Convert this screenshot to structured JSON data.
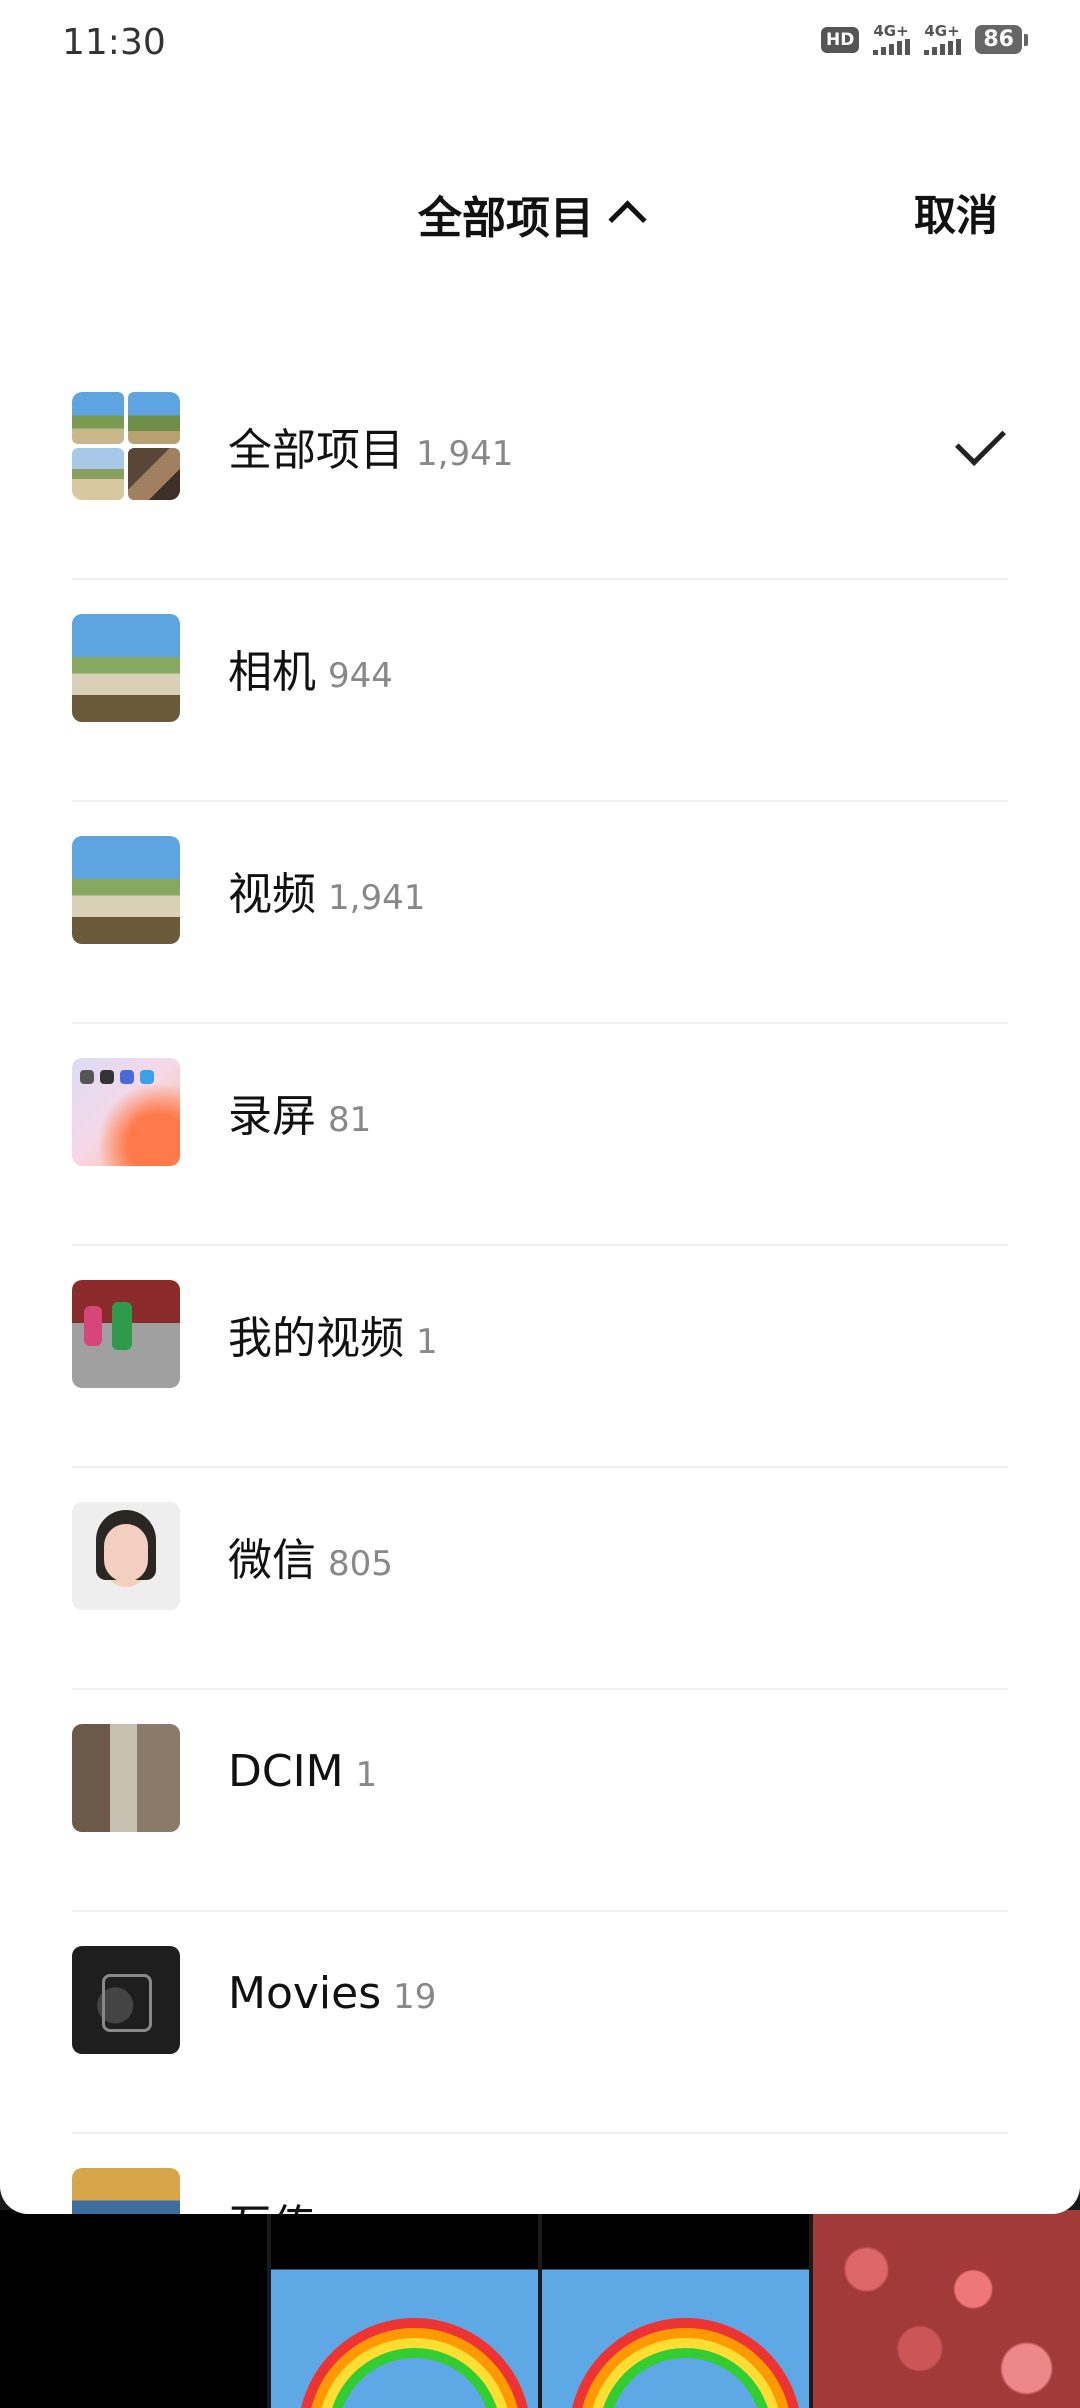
{
  "status_bar": {
    "time": "11:30",
    "hd_label": "HD",
    "network_1": "4G+",
    "network_2": "4G+",
    "battery": "86"
  },
  "header": {
    "title": "全部项目",
    "cancel_label": "取消"
  },
  "albums": [
    {
      "name": "全部项目",
      "count": "1,941",
      "selected": true
    },
    {
      "name": "相机",
      "count": "944",
      "selected": false
    },
    {
      "name": "视频",
      "count": "1,941",
      "selected": false
    },
    {
      "name": "录屏",
      "count": "81",
      "selected": false
    },
    {
      "name": "我的视频",
      "count": "1",
      "selected": false
    },
    {
      "name": "微信",
      "count": "805",
      "selected": false
    },
    {
      "name": "DCIM",
      "count": "1",
      "selected": false
    },
    {
      "name": "Movies",
      "count": "19",
      "selected": false
    },
    {
      "name": "互传",
      "count": "",
      "selected": false
    }
  ]
}
